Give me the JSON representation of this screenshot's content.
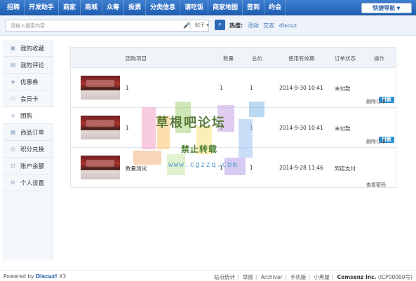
{
  "topnav": {
    "items": [
      "招聘",
      "开发助手",
      "商家",
      "商城",
      "众筹",
      "投票",
      "分类信息",
      "请吃饭",
      "商家地图",
      "签到",
      "约会"
    ],
    "quick_nav": "快捷导航"
  },
  "search": {
    "placeholder": "请输入搜索内容",
    "scope": "帖子",
    "hot_label": "热搜:",
    "hot_words": [
      "活动",
      "交友",
      "discuz"
    ]
  },
  "sidebar": {
    "items": [
      {
        "label": "我的收藏",
        "icon": "favorite-icon"
      },
      {
        "label": "我的评论",
        "icon": "comment-icon"
      },
      {
        "label": "优惠券",
        "icon": "coupon-icon"
      },
      {
        "label": "会员卡",
        "icon": "member-card-icon"
      },
      {
        "label": "团购",
        "icon": "group-buy-icon",
        "active": true
      },
      {
        "label": "商品订单",
        "icon": "order-icon"
      },
      {
        "label": "积分兑换",
        "icon": "points-icon"
      },
      {
        "label": "账户余额",
        "icon": "balance-icon"
      },
      {
        "label": "个人设置",
        "icon": "settings-icon"
      }
    ]
  },
  "table": {
    "headers": [
      "团购项目",
      "数量",
      "总价",
      "使用有效期",
      "订单状态",
      "操作"
    ],
    "rows": [
      {
        "name": "1",
        "qty": "1",
        "total": "1",
        "valid": "2014-9-30 10:41",
        "status": "未付款",
        "pay": "付款",
        "action": "删除订单"
      },
      {
        "name": "1",
        "qty": "1",
        "total": "1",
        "valid": "2014-9-30 10:41",
        "status": "未付款",
        "pay": "付款",
        "action": "删除订单"
      },
      {
        "name": "数量测试",
        "qty": "1",
        "total": "1",
        "valid": "2014-9-28 11:46",
        "status": "到店支付",
        "pay": "",
        "action": "查看密码"
      }
    ]
  },
  "watermark": {
    "title": "草根吧论坛",
    "subtitle": "禁止转载",
    "url": "www.cgzzq.com"
  },
  "footer": {
    "powered_prefix": "Powered by ",
    "powered_brand": "Discuz!",
    "powered_version": " X3",
    "links": [
      "站点统计",
      "举报",
      "Archiver",
      "手机版",
      "小黑屋"
    ],
    "company": "Comsenz Inc.",
    "icp": "(ICP00000号)"
  },
  "colors": {
    "nav_bg": "#2a68b8",
    "pay_button": "#2a8fd6",
    "accent_link": "#3a6eb0"
  }
}
